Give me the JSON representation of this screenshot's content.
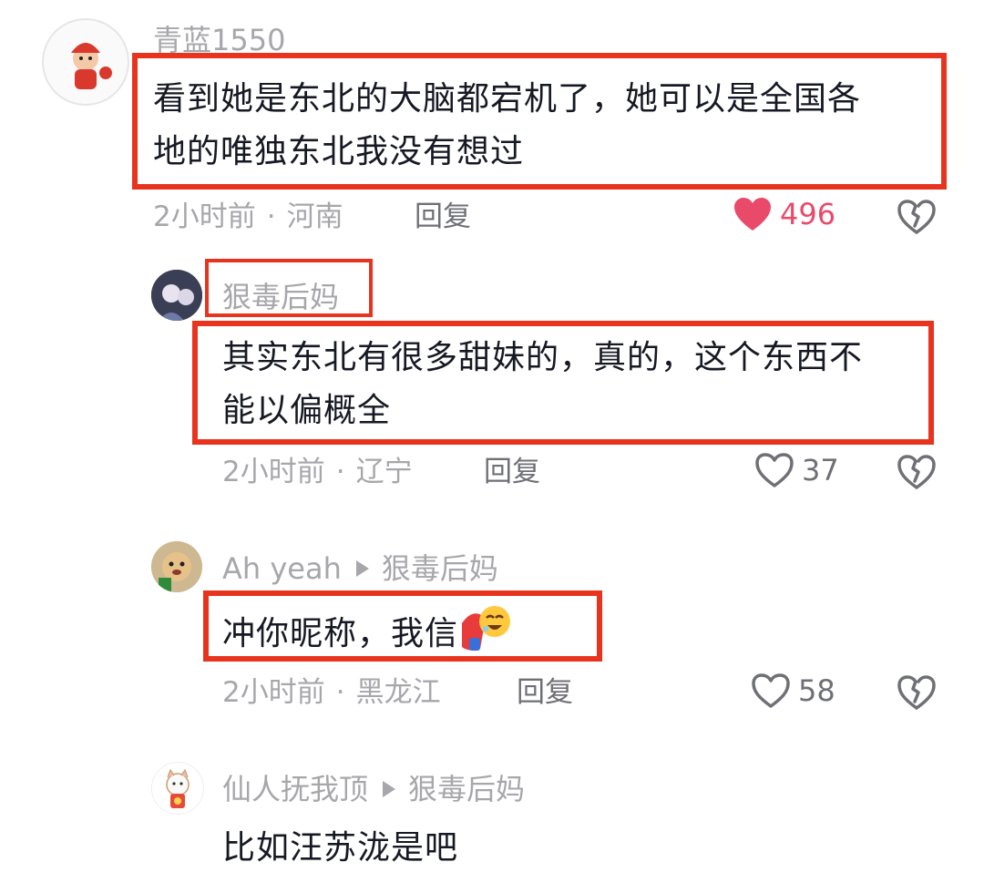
{
  "comments": [
    {
      "username": "青蓝1550",
      "text_line1": "看到她是东北的大脑都宕机了，她可以是全国各",
      "text_line2": "地的唯独东北我没有想过",
      "time": "2小时前",
      "location": "河南",
      "reply_label": "回复",
      "likes": "496",
      "liked": true
    },
    {
      "username": "狠毒后妈",
      "text_line1": "其实东北有很多甜妹的，真的，这个东西不",
      "text_line2": "能以偏概全",
      "time": "2小时前",
      "location": "辽宁",
      "reply_label": "回复",
      "likes": "37",
      "liked": false
    },
    {
      "username": "Ah yeah",
      "reply_to": "狠毒后妈",
      "text": "冲你昵称，我信",
      "time": "2小时前",
      "location": "黑龙江",
      "reply_label": "回复",
      "likes": "58",
      "liked": false
    },
    {
      "username": "仙人抚我顶",
      "reply_to": "狠毒后妈",
      "text": "比如汪苏泷是吧"
    }
  ],
  "meta_separator": "·",
  "colors": {
    "highlight_box": "#e8341e",
    "like_red": "#ea4a6a",
    "muted_text": "#a7a7ab"
  },
  "icons": {
    "like": "heart-icon",
    "dislike": "broken-heart-icon",
    "reply_arrow": "triangle-right-icon"
  }
}
